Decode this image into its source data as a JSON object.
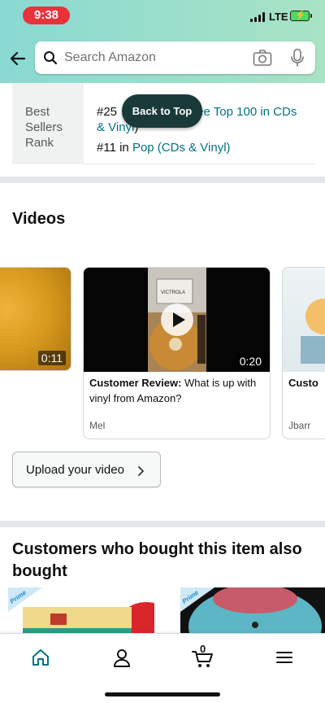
{
  "status_bar": {
    "time": "9:38",
    "network": "LTE"
  },
  "header": {
    "search_placeholder": "Search Amazon",
    "icons": [
      "back-arrow-icon",
      "search-icon",
      "camera-icon",
      "mic-icon"
    ]
  },
  "back_to_top": "Back to Top",
  "best_sellers": {
    "label": "Best Sellers Rank",
    "line1_prefix": "#25",
    "line1_link": "See Top 100 in CDs & Vinyl",
    "line1_suffix": ")",
    "line2_prefix": "#11 in",
    "line2_link": "Pop (CDs & Vinyl)"
  },
  "videos": {
    "title": "Videos",
    "items": [
      {
        "duration": "0:11"
      },
      {
        "duration": "0:20",
        "title_bold": "Customer Review:",
        "title_rest": " What is up with vinyl from Amazon?",
        "author": "Mel"
      },
      {
        "title_bold": "Custo",
        "author": "Jbarr"
      }
    ],
    "upload_label": "Upload your video"
  },
  "also_bought": {
    "title": "Customers who bought this item also bought",
    "badge": "Prime"
  },
  "bottom_nav": {
    "items": [
      "home-icon",
      "account-icon",
      "cart-icon",
      "menu-icon"
    ],
    "cart_count": "0"
  },
  "colors": {
    "accent": "#007185",
    "header_gradient_start": "#8ad9d2",
    "header_gradient_end": "#a8e3c4",
    "active_nav": "#007185"
  }
}
